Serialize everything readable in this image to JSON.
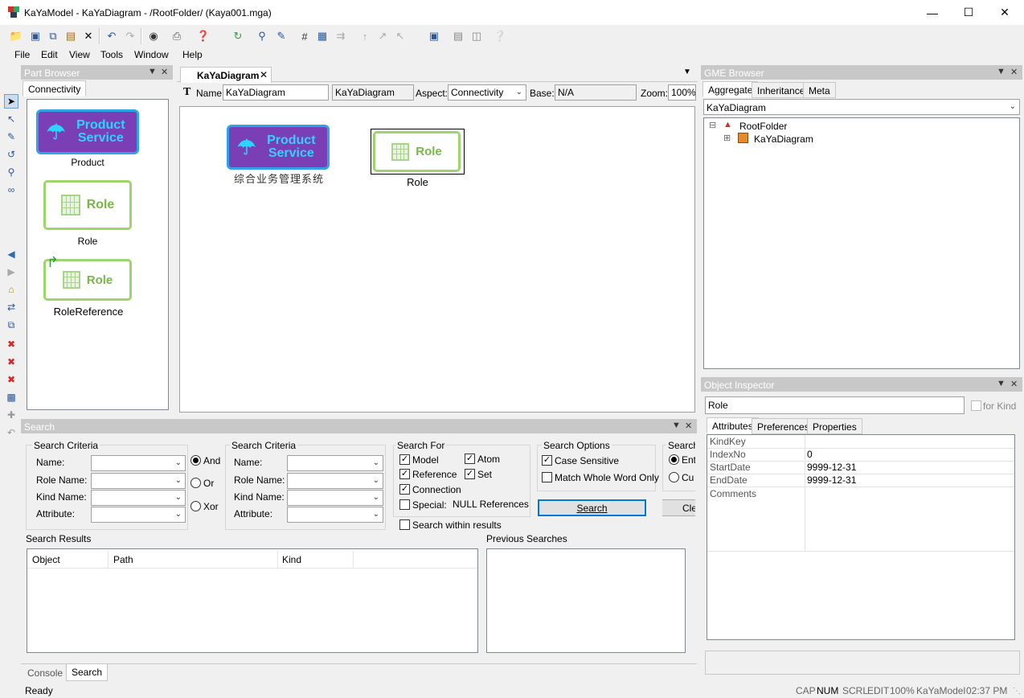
{
  "window": {
    "title": "KaYaModel - KaYaDiagram - /RootFolder/ (Kaya001.mga)",
    "minimize": "—",
    "maximize": "☐",
    "close": "✕"
  },
  "menu": [
    "File",
    "Edit",
    "View",
    "Tools",
    "Window",
    "Help"
  ],
  "part_browser": {
    "title": "Part Browser",
    "tab": "Connectivity",
    "parts": [
      {
        "icon_text": "Product Service",
        "label": "Product"
      },
      {
        "icon_text": "Role",
        "label": "Role"
      },
      {
        "icon_text": "Role",
        "label": "RoleReference"
      }
    ]
  },
  "editor": {
    "tab": "KaYaDiagram",
    "name_label": "Name:",
    "name_value": "KaYaDiagram",
    "kind_value": "KaYaDiagram",
    "aspect_label": "Aspect:",
    "aspect_value": "Connectivity",
    "base_label": "Base:",
    "base_value": "N/A",
    "zoom_label": "Zoom:",
    "zoom_value": "100%",
    "objects": [
      {
        "icon_text": "Product Service",
        "label": "综合业务管理系统"
      },
      {
        "icon_text": "Role",
        "label": "Role"
      }
    ]
  },
  "gme_browser": {
    "title": "GME Browser",
    "tabs": [
      "Aggregate",
      "Inheritance",
      "Meta"
    ],
    "combo": "KaYaDiagram",
    "tree": [
      {
        "label": "RootFolder",
        "expander": "⊟"
      },
      {
        "label": "KaYaDiagram",
        "expander": "⊞"
      }
    ]
  },
  "object_inspector": {
    "title": "Object Inspector",
    "name": "Role",
    "for_kind": "for Kind",
    "tabs": [
      "Attributes",
      "Preferences",
      "Properties"
    ],
    "attributes": [
      {
        "key": "KindKey",
        "value": ""
      },
      {
        "key": "IndexNo",
        "value": "0"
      },
      {
        "key": "StartDate",
        "value": "9999-12-31"
      },
      {
        "key": "EndDate",
        "value": "9999-12-31"
      },
      {
        "key": "Comments",
        "value": ""
      }
    ]
  },
  "search": {
    "title": "Search",
    "criteria_title": "Search Criteria",
    "criteria_labels": [
      "Name:",
      "Role Name:",
      "Kind Name:",
      "Attribute:"
    ],
    "logic": [
      "And",
      "Or",
      "Xor"
    ],
    "search_for_title": "Search For",
    "search_for": [
      {
        "label": "Model",
        "checked": true
      },
      {
        "label": "Atom",
        "checked": true
      },
      {
        "label": "Reference",
        "checked": true
      },
      {
        "label": "Set",
        "checked": true
      },
      {
        "label": "Connection",
        "checked": true
      },
      {
        "label": "Special:",
        "checked": false
      }
    ],
    "null_refs": "NULL References",
    "options_title": "Search Options",
    "options": [
      {
        "label": "Case Sensitive",
        "checked": true
      },
      {
        "label": "Match Whole Word Only",
        "checked": false
      }
    ],
    "scope_title": "Search",
    "scope": [
      "Ent",
      "Cu"
    ],
    "search_button": "Search",
    "clear_button": "Cle",
    "within_results": "Search within results",
    "results_title": "Search Results",
    "columns": [
      "Object",
      "Path",
      "Kind"
    ],
    "previous_title": "Previous Searches"
  },
  "bottom_tabs": [
    "Console",
    "Search"
  ],
  "status": {
    "text": "Ready",
    "indicators": [
      "CAP",
      "NUM",
      "SCRL",
      "EDIT",
      "100%",
      "KaYaModel",
      "02:37  PM"
    ]
  },
  "colors": {
    "accent": "#7b3fb5",
    "cyan": "#2fd3ff",
    "role_green": "#7ab648",
    "pane_header": "#c8c8c8"
  }
}
